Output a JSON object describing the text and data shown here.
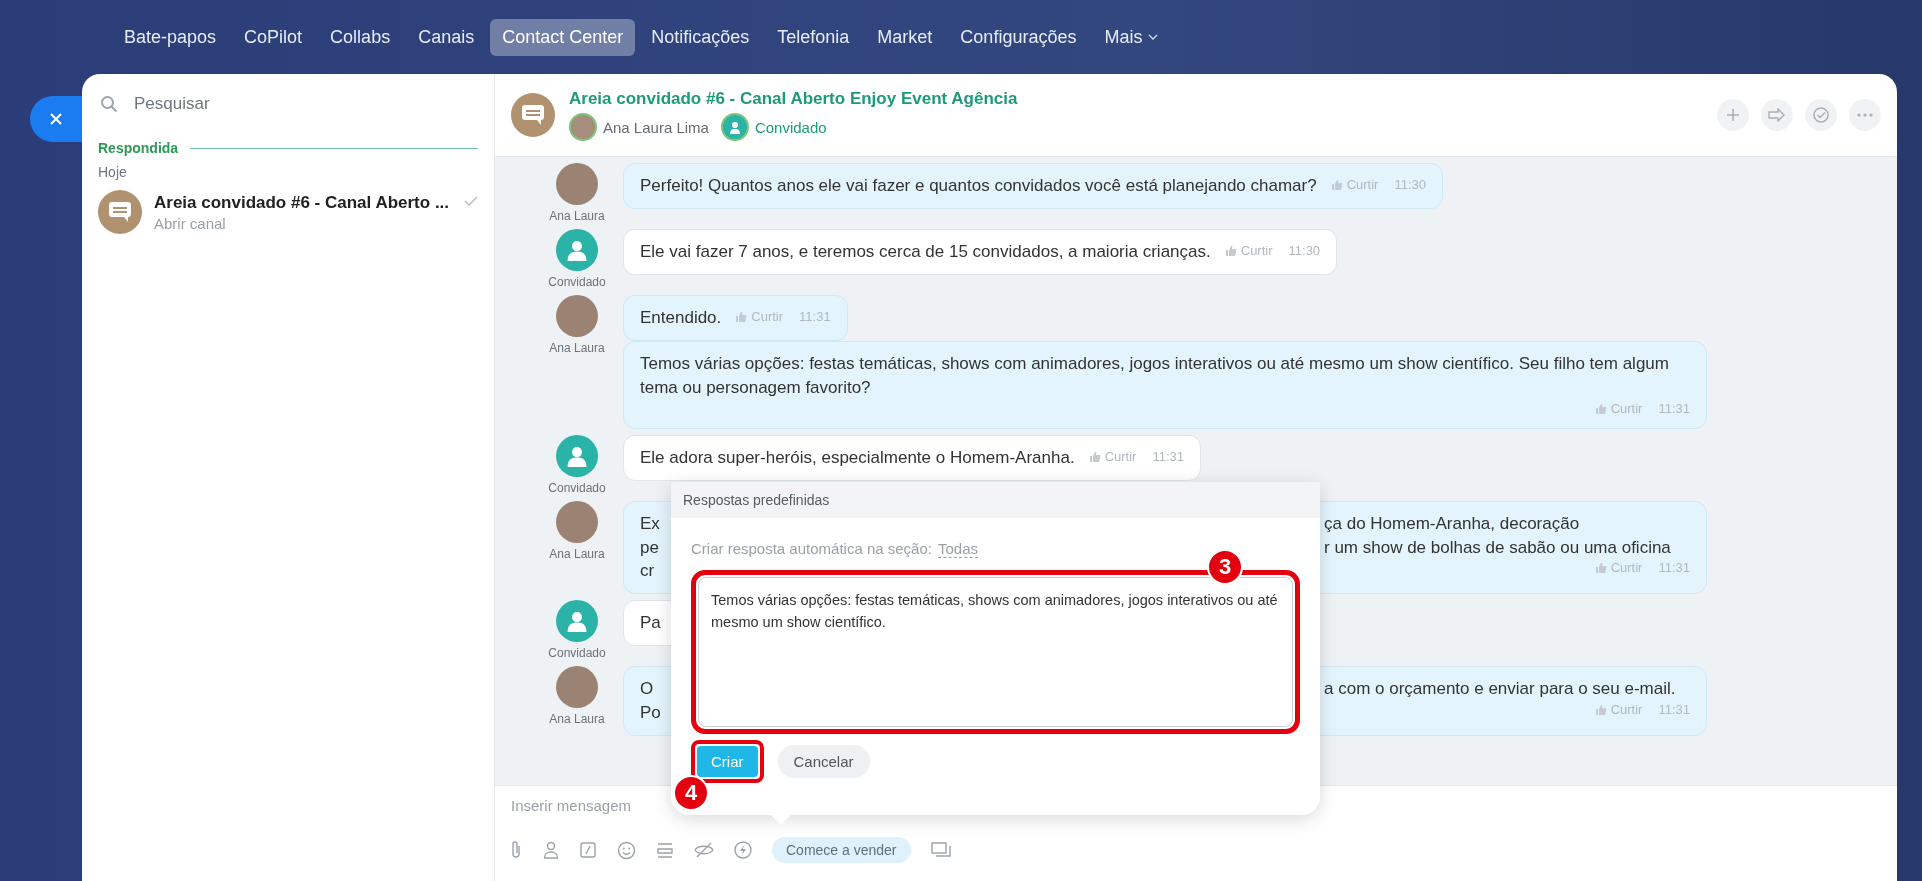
{
  "nav": {
    "items": [
      {
        "label": "Bate-papos",
        "selected": false
      },
      {
        "label": "CoPilot",
        "selected": false
      },
      {
        "label": "Collabs",
        "selected": false
      },
      {
        "label": "Canais",
        "selected": false
      },
      {
        "label": "Contact Center",
        "selected": true
      },
      {
        "label": "Notificações",
        "selected": false
      },
      {
        "label": "Telefonia",
        "selected": false
      },
      {
        "label": "Market",
        "selected": false
      },
      {
        "label": "Configurações",
        "selected": false
      }
    ],
    "more": "Mais"
  },
  "sidebar": {
    "search": {
      "placeholder": "Pesquisar"
    },
    "group": "Respondida",
    "date": "Hoje",
    "items": [
      {
        "title": "Areia convidado #6 - Canal Aberto ...",
        "subtitle": "Abrir canal",
        "read": true
      }
    ]
  },
  "chat": {
    "title": "Areia convidado #6 - Canal Aberto Enjoy Event Agência",
    "participants": [
      {
        "name": "Ana Laura Lima",
        "kind": "agent"
      },
      {
        "name": "Convidado",
        "kind": "guest"
      }
    ],
    "messages": [
      {
        "kind": "agent",
        "author": "Ana Laura",
        "text": "Perfeito! Quantos anos ele vai fazer e quantos convidados você está planejando chamar?",
        "like": "Curtir",
        "time": "11:30"
      },
      {
        "kind": "guest",
        "author": "Convidado",
        "text": "Ele vai fazer 7 anos, e teremos cerca de 15 convidados, a maioria crianças.",
        "like": "Curtir",
        "time": "11:30"
      },
      {
        "kind": "agent",
        "author": "Ana Laura",
        "text": "Entendido.",
        "like": "Curtir",
        "time": "11:31"
      },
      {
        "kind": "agent",
        "text": "Temos várias opções: festas temáticas, shows com animadores, jogos interativos ou até mesmo um show científico. Seu filho tem algum tema ou personagem favorito?",
        "like": "Curtir",
        "time": "11:31"
      },
      {
        "kind": "guest",
        "author": "Convidado",
        "text": "Ele adora super-heróis, especialmente o Homem-Aranha.",
        "like": "Curtir",
        "time": "11:31"
      },
      {
        "kind": "agent",
        "author": "Ana Laura",
        "text_left": [
          "Ex",
          "pe",
          "cr"
        ],
        "text_right": [
          "ça do Homem-Aranha, decoração",
          "r um show de bolhas de sabão ou uma oficina"
        ],
        "like": "Curtir",
        "time": "11:31"
      },
      {
        "kind": "guest",
        "author": "Convidado",
        "text_left": [
          "Pa"
        ]
      },
      {
        "kind": "agent",
        "author": "Ana Laura",
        "text_left": [
          "O",
          "Po"
        ],
        "text_right": [
          "a com o orçamento e enviar para o seu e-mail."
        ],
        "like": "Curtir",
        "time": "11:31"
      }
    ]
  },
  "popup": {
    "title": "Respostas predefinidas",
    "section_label": "Criar resposta automática na seção:",
    "section_link": "Todas",
    "answer": "Temos várias opções: festas temáticas, shows com animadores, jogos interativos ou até mesmo um show científico.",
    "create": "Criar",
    "cancel": "Cancelar",
    "annotations": [
      "3",
      "4"
    ]
  },
  "composer": {
    "placeholder": "Inserir mensagem",
    "sell_button": "Comece a vender"
  }
}
